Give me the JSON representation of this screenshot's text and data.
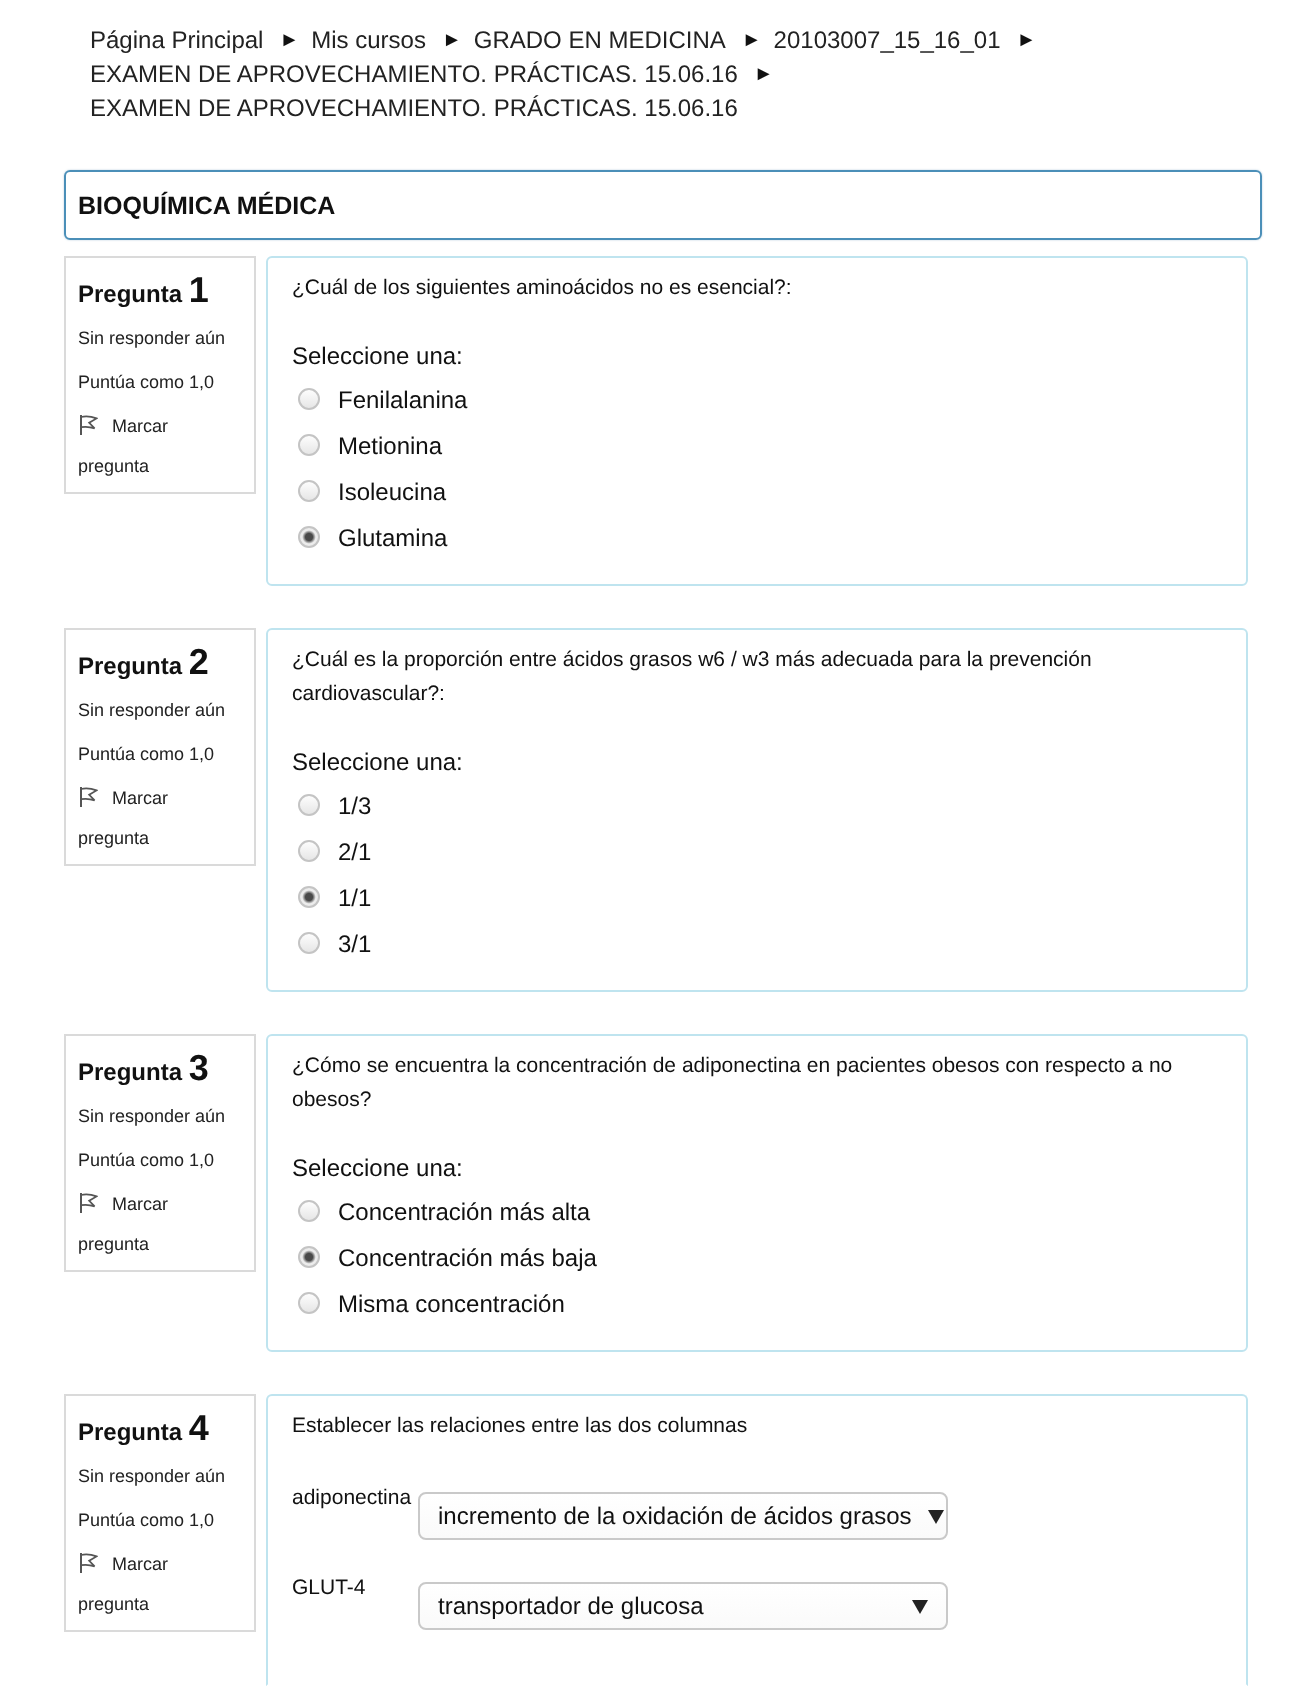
{
  "breadcrumb": [
    {
      "label": "Página Principal",
      "separator": "►"
    },
    {
      "label": "Mis cursos",
      "separator": "►"
    },
    {
      "label": "GRADO EN MEDICINA",
      "separator": "►"
    },
    {
      "label": "20103007_15_16_01",
      "separator": "►"
    },
    {
      "label": "EXAMEN DE APROVECHAMIENTO. PRÁCTICAS. 15.06.16",
      "separator": "►"
    },
    {
      "label": "EXAMEN DE APROVECHAMIENTO. PRÁCTICAS. 15.06.16"
    }
  ],
  "section_title": "BIOQUÍMICA MÉDICA",
  "questions": [
    {
      "kind": "multichoice",
      "label": "Pregunta",
      "number": "1",
      "status": "Sin responder aún",
      "grade": "Puntúa como 1,0",
      "flag": {
        "label": "Marcar pregunta",
        "flagged": false
      },
      "text": "¿Cuál de los siguientes aminoácidos no es esencial?:",
      "prompt": "Seleccione una:",
      "options": [
        {
          "label": "Fenilalanina",
          "selected": false
        },
        {
          "label": "Metionina",
          "selected": false
        },
        {
          "label": "Isoleucina",
          "selected": false
        },
        {
          "label": "Glutamina",
          "selected": true
        }
      ]
    },
    {
      "kind": "multichoice",
      "label": "Pregunta",
      "number": "2",
      "status": "Sin responder aún",
      "grade": "Puntúa como 1,0",
      "flag": {
        "label": "Marcar pregunta",
        "flagged": false
      },
      "text": "¿Cuál es la proporción entre ácidos grasos w6 / w3 más adecuada para la prevención cardiovascular?:",
      "prompt": "Seleccione una:",
      "options": [
        {
          "label": "1/3",
          "selected": false
        },
        {
          "label": "2/1",
          "selected": false
        },
        {
          "label": "1/1",
          "selected": true
        },
        {
          "label": "3/1",
          "selected": false
        }
      ]
    },
    {
      "kind": "multichoice",
      "label": "Pregunta",
      "number": "3",
      "status": "Sin responder aún",
      "grade": "Puntúa como 1,0",
      "flag": {
        "label": "Marcar pregunta",
        "flagged": false
      },
      "text": "¿Cómo se encuentra la concentración de adiponectina en pacientes obesos con respecto a no obesos?",
      "prompt": "Seleccione una:",
      "options": [
        {
          "label": "Concentración más alta",
          "selected": false
        },
        {
          "label": "Concentración más baja",
          "selected": true
        },
        {
          "label": "Misma concentración",
          "selected": false
        }
      ]
    },
    {
      "kind": "match",
      "label": "Pregunta",
      "number": "4",
      "status": "Sin responder aún",
      "grade": "Puntúa como 1,0",
      "flag": {
        "label": "Marcar pregunta",
        "flagged": false
      },
      "text": "Establecer las relaciones entre las dos columnas",
      "pairs": [
        {
          "stem": "adiponectina",
          "answer": "incremento de la oxidación de ácidos grasos"
        },
        {
          "stem": "GLUT-4",
          "answer": "transportador de glucosa"
        }
      ]
    }
  ]
}
